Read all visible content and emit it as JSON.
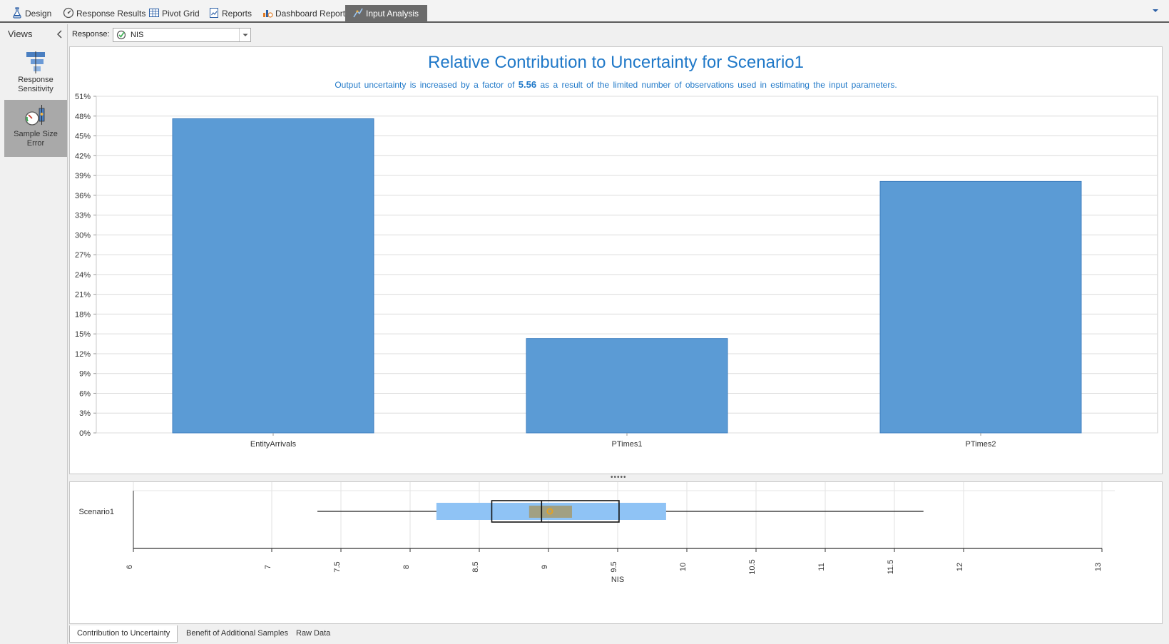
{
  "tabs": [
    {
      "label": "Design",
      "icon": "flask-icon"
    },
    {
      "label": "Response Results",
      "icon": "gauge-icon"
    },
    {
      "label": "Pivot Grid",
      "icon": "grid-icon"
    },
    {
      "label": "Reports",
      "icon": "report-icon"
    },
    {
      "label": "Dashboard Reports",
      "icon": "dashboard-icon"
    },
    {
      "label": "Input Analysis",
      "icon": "input-analysis-icon",
      "active": true
    }
  ],
  "views": {
    "title": "Views",
    "items": [
      {
        "label": "Response Sensitivity",
        "icon": "sensitivity-icon"
      },
      {
        "label": "Sample Size Error",
        "icon": "sample-size-icon",
        "active": true
      }
    ]
  },
  "response": {
    "label": "Response:",
    "value": "NIS"
  },
  "contribution_chart": {
    "title": "Relative Contribution to Uncertainty for Scenario1",
    "subtitle_before": "Output uncertainty is increased by a factor of",
    "factor": "5.56",
    "subtitle_after": "as a result of the limited number of observations used in estimating the input parameters."
  },
  "chart_data": [
    {
      "type": "bar",
      "title": "Relative Contribution to Uncertainty for Scenario1",
      "categories": [
        "EntityArrivals",
        "PTimes1",
        "PTimes2"
      ],
      "values": [
        47.6,
        14.3,
        38.1
      ],
      "ylim": [
        0,
        51
      ],
      "yticks": [
        0,
        3,
        6,
        9,
        12,
        15,
        18,
        21,
        24,
        27,
        30,
        33,
        36,
        39,
        42,
        45,
        48,
        51
      ],
      "ytick_suffix": "%",
      "grid": true,
      "bar_color": "#5b9bd5"
    },
    {
      "type": "boxplot",
      "orientation": "horizontal",
      "categories": [
        "Scenario1"
      ],
      "xlabel": "NIS",
      "xlim": [
        6,
        13
      ],
      "xticks": [
        6,
        7,
        7.5,
        8,
        8.5,
        9,
        9.5,
        10,
        10.5,
        11,
        11.5,
        12,
        13
      ],
      "series": [
        {
          "min": 7.33,
          "q1": 8.59,
          "median": 8.95,
          "q3": 9.51,
          "max": 11.71,
          "mean": 9.01,
          "outer_ci": [
            8.19,
            9.85
          ],
          "inner_ci": [
            8.86,
            9.17
          ]
        }
      ]
    }
  ],
  "bottom_tabs": [
    "Contribution to Uncertainty",
    "Benefit of Additional Samples",
    "Raw Data"
  ],
  "colors": {
    "accent": "#1f78c8",
    "bar": "#5b9bd5",
    "box_ci": "#8fc3f5",
    "inner_ci": "#a49a6f",
    "mean_marker": "#e8a21e",
    "active_tab": "#6b6b6b"
  }
}
